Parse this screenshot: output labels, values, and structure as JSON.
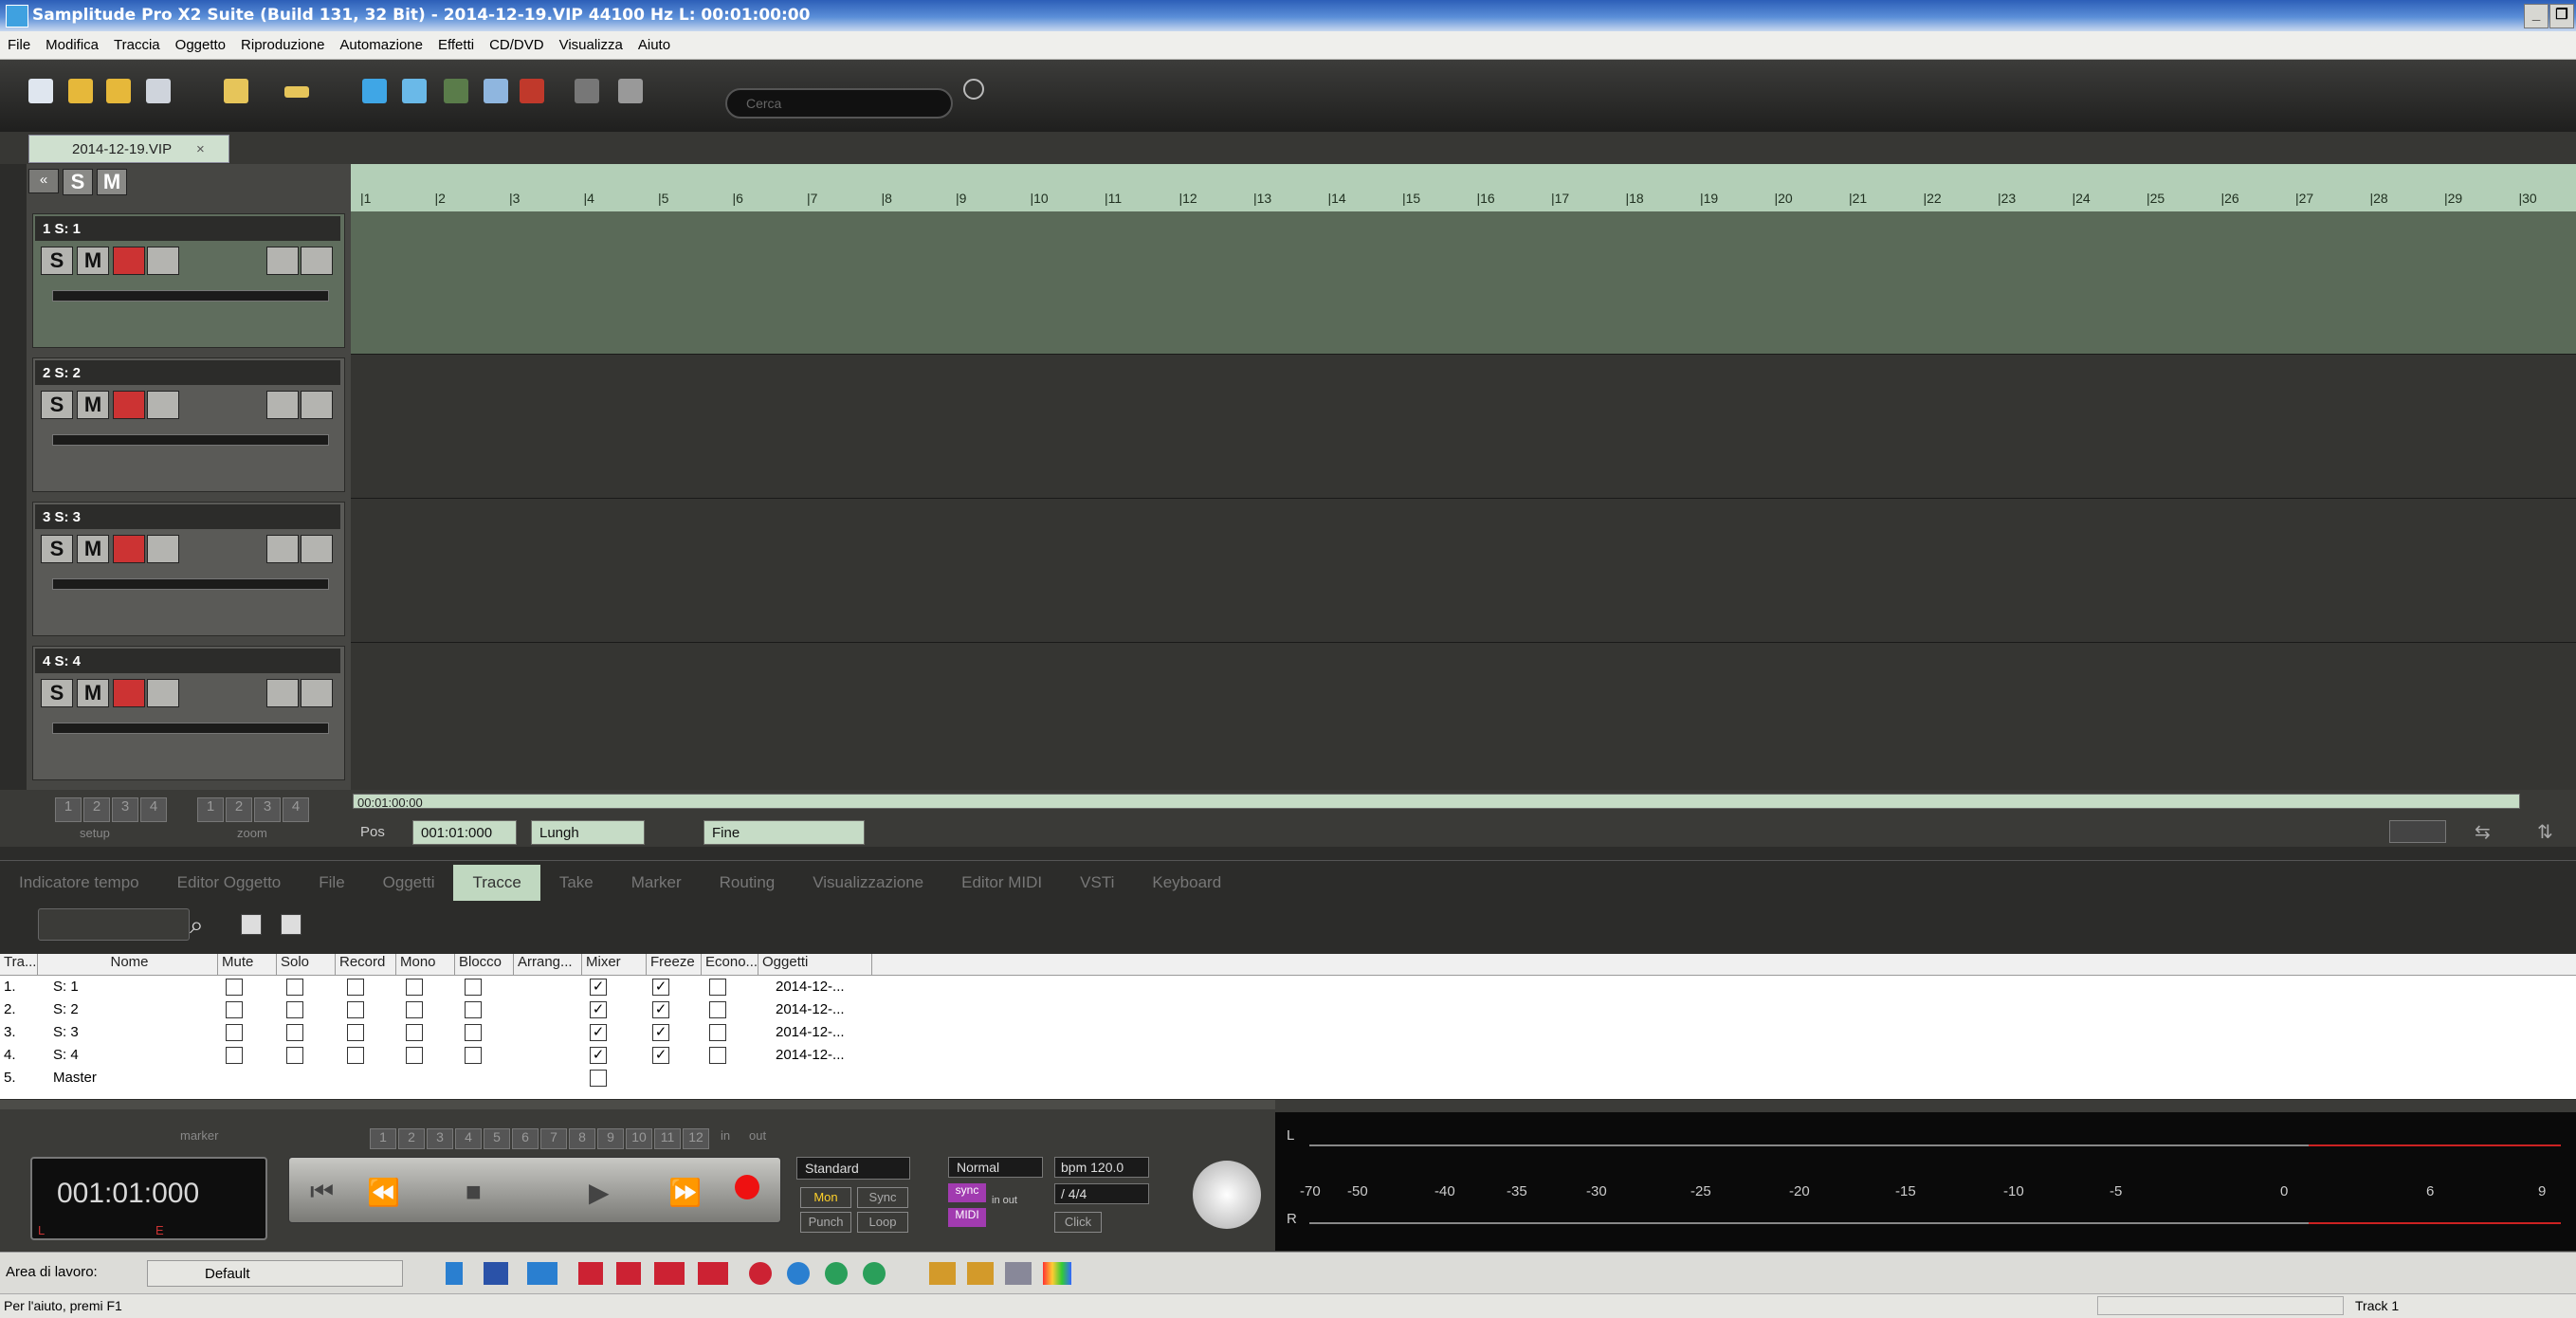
{
  "window": {
    "title": "Samplitude Pro X2 Suite (Build 131, 32 Bit)  -  2014-12-19.VIP  44100 Hz L: 00:01:00:00"
  },
  "menu": [
    "File",
    "Modifica",
    "Traccia",
    "Oggetto",
    "Riproduzione",
    "Automazione",
    "Effetti",
    "CD/DVD",
    "Visualizza",
    "Aiuto"
  ],
  "toolbar": {
    "search_placeholder": "Cerca"
  },
  "project_tab": {
    "label": "2014-12-19.VIP",
    "close": "×"
  },
  "solo_mute_header": {
    "solo": "S",
    "mute": "M"
  },
  "tracks": [
    {
      "label": "1  S: 1"
    },
    {
      "label": "2  S: 2"
    },
    {
      "label": "3  S: 3"
    },
    {
      "label": "4  S: 4"
    }
  ],
  "track_buttons": {
    "solo": "S",
    "mute": "M"
  },
  "ruler": [
    "1",
    "2",
    "3",
    "4",
    "5",
    "6",
    "7",
    "8",
    "9",
    "10",
    "11",
    "12",
    "13",
    "14",
    "15",
    "16",
    "17",
    "18",
    "19",
    "20",
    "21",
    "22",
    "23",
    "24",
    "25",
    "26",
    "27",
    "28",
    "29",
    "30"
  ],
  "posbar": {
    "setup_nums": [
      "1",
      "2",
      "3",
      "4"
    ],
    "zoom_nums": [
      "1",
      "2",
      "3",
      "4"
    ],
    "setup_label": "setup",
    "zoom_label": "zoom",
    "time": "00:01:00:00",
    "pos_label": "Pos",
    "pos_value": "001:01:000",
    "lungh_label": "Lungh",
    "fine_label": "Fine"
  },
  "bottom_tabs": [
    "Indicatore tempo",
    "Editor Oggetto",
    "File",
    "Oggetti",
    "Tracce",
    "Take",
    "Marker",
    "Routing",
    "Visualizzazione",
    "Editor MIDI",
    "VSTi",
    "Keyboard"
  ],
  "active_tab": "Tracce",
  "table": {
    "headers": [
      "Tra...",
      "Nome",
      "Mute",
      "Solo",
      "Record",
      "Mono",
      "Blocco",
      "Arrang...",
      "Mixer",
      "Freeze",
      "Econo...",
      "Oggetti"
    ],
    "rows": [
      {
        "num": "1.",
        "name": "S: 1",
        "oggetti": "2014-12-..."
      },
      {
        "num": "2.",
        "name": "S: 2",
        "oggetti": "2014-12-..."
      },
      {
        "num": "3.",
        "name": "S: 3",
        "oggetti": "2014-12-..."
      },
      {
        "num": "4.",
        "name": "S: 4",
        "oggetti": "2014-12-..."
      },
      {
        "num": "5.",
        "name": "Master",
        "oggetti": ""
      }
    ]
  },
  "transport": {
    "marker_label": "marker",
    "marker_nums": [
      "1",
      "2",
      "3",
      "4",
      "5",
      "6",
      "7",
      "8",
      "9",
      "10",
      "11",
      "12"
    ],
    "in_label": "in",
    "out_label": "out",
    "counter": "001:01:000",
    "counter_l": "L",
    "counter_e": "E",
    "mode": "Standard",
    "mon": "Mon",
    "sync": "Sync",
    "punch": "Punch",
    "loop": "Loop",
    "normal": "Normal",
    "bpm": "bpm 120.0",
    "sig": "/  4/4",
    "click": "Click",
    "sync_led": "sync",
    "midi_led": "MIDI",
    "in_out": "in out"
  },
  "meter": {
    "labels": [
      "-70",
      "-50",
      "-40",
      "-35",
      "-30",
      "-25",
      "-20",
      "-15",
      "-10",
      "-5",
      "0",
      "6",
      "9"
    ],
    "l": "L",
    "r": "R"
  },
  "workspace": {
    "label": "Area di lavoro:",
    "value": "Default"
  },
  "status": {
    "help": "Per l'aiuto, premi F1",
    "track": "Track 1"
  }
}
